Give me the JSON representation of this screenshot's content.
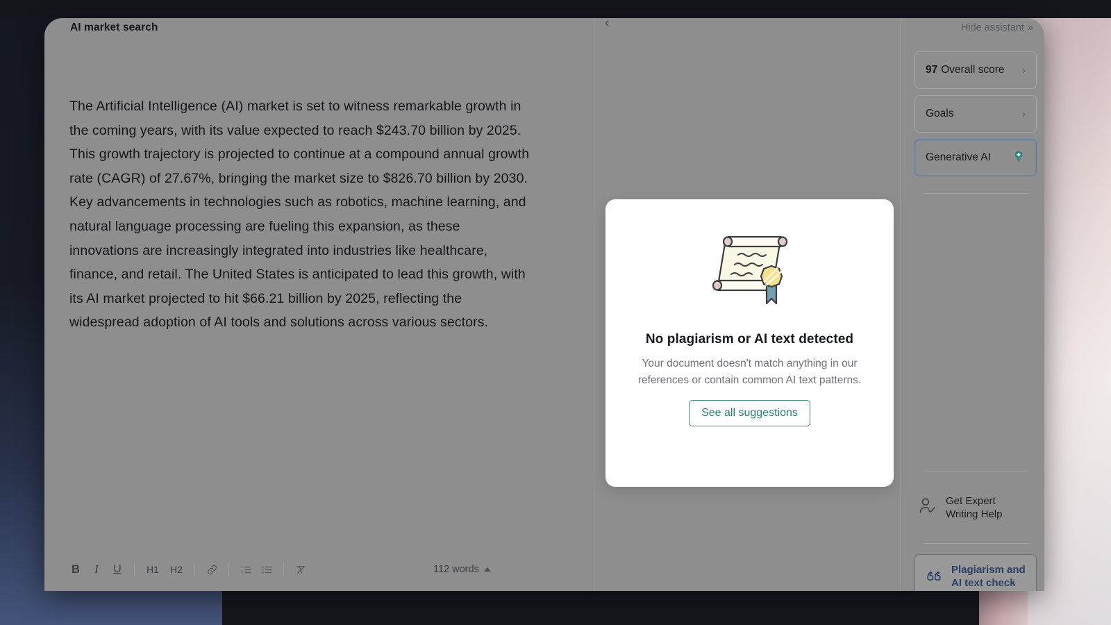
{
  "window": {
    "doc_title": "AI market search"
  },
  "editor": {
    "body_text": "The Artificial Intelligence (AI) market is set to witness remarkable growth in the coming years, with its value expected to reach $243.70 billion by 2025. This growth trajectory is projected to continue at a compound annual growth rate (CAGR) of 27.67%, bringing the market size to $826.70 billion by 2030. Key advancements in technologies such as robotics, machine learning, and natural language processing are fueling this expansion, as these innovations are increasingly integrated into industries like healthcare, finance, and retail. The United States is anticipated to lead this growth, with its AI market projected to hit $66.21 billion by 2025, reflecting the widespread adoption of AI tools and solutions across various sectors.",
    "word_count": "112 words",
    "toolbar": {
      "bold": "B",
      "italic": "I",
      "underline": "U",
      "heading1": "H1",
      "heading2": "H2",
      "link": "link-icon",
      "numbered_list": "numbered-list-icon",
      "bulleted_list": "bulleted-list-icon",
      "clear_format": "clear-formatting-icon"
    }
  },
  "plagiarism_modal": {
    "title": "No plagiarism or AI text detected",
    "subtitle": "Your document doesn't match anything in our references or contain common AI text patterns.",
    "button_label": "See all suggestions",
    "illustration": "scroll-certificate-icon"
  },
  "sidebar": {
    "hide_label": "Hide assistant",
    "hide_icon": "double-chevron-right-icon",
    "cards": [
      {
        "score": "97",
        "label": "Overall score",
        "chevron": "chevron-right-icon"
      },
      {
        "label": "Goals",
        "chevron": "chevron-right-icon"
      },
      {
        "label": "Generative AI",
        "icon": "lightbulb-icon"
      }
    ],
    "expert_help": {
      "label_line1": "Get Expert",
      "label_line2": "Writing Help",
      "icon": "person-check-icon"
    },
    "plagiarism_check": {
      "label_line1": "Plagiarism and",
      "label_line2": "AI text check",
      "icon": "quotation-mark-icon"
    }
  },
  "colors": {
    "accent_teal": "#2c7c75",
    "accent_blue": "#2b3f66",
    "card_border": "#a4a4a4",
    "genai_border": "#5f7fa8",
    "overlay_grey": "#8e8e8e"
  }
}
